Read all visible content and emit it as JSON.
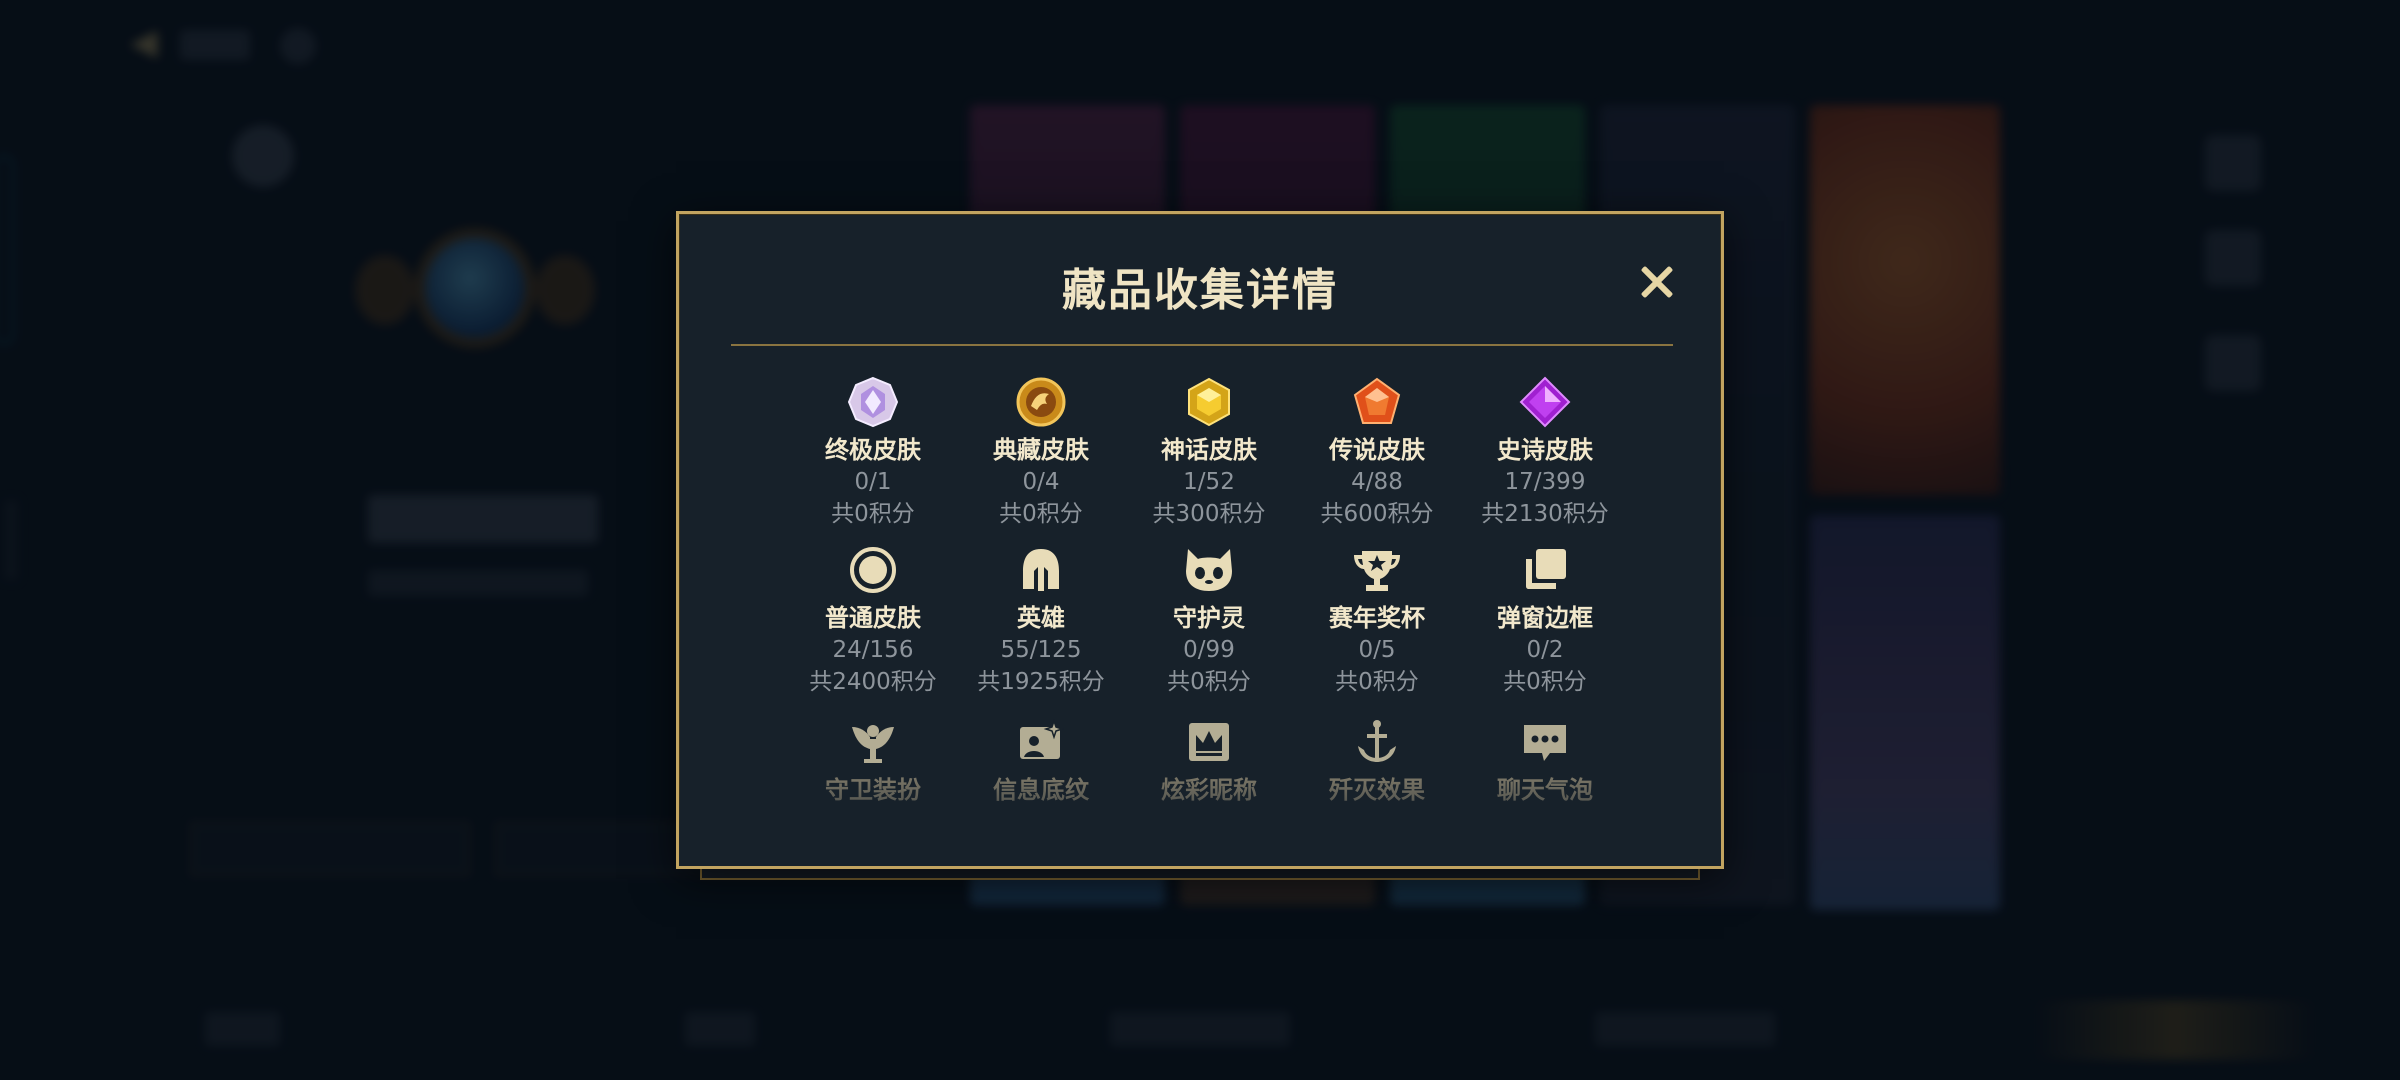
{
  "modal": {
    "title": "藏品收集详情",
    "close_icon": "close-icon"
  },
  "collections": [
    {
      "name": "终极皮肤",
      "count": "0/1",
      "points": "共0积分",
      "icon": "ultimate-gem-icon"
    },
    {
      "name": "典藏皮肤",
      "count": "0/4",
      "points": "共0积分",
      "icon": "dragon-coin-icon"
    },
    {
      "name": "神话皮肤",
      "count": "1/52",
      "points": "共300积分",
      "icon": "mythic-gem-icon"
    },
    {
      "name": "传说皮肤",
      "count": "4/88",
      "points": "共600积分",
      "icon": "legendary-gem-icon"
    },
    {
      "name": "史诗皮肤",
      "count": "17/399",
      "points": "共2130积分",
      "icon": "epic-gem-icon"
    },
    {
      "name": "普通皮肤",
      "count": "24/156",
      "points": "共2400积分",
      "icon": "ring-icon"
    },
    {
      "name": "英雄",
      "count": "55/125",
      "points": "共1925积分",
      "icon": "helmet-icon"
    },
    {
      "name": "守护灵",
      "count": "0/99",
      "points": "共0积分",
      "icon": "guardian-pet-icon"
    },
    {
      "name": "赛年奖杯",
      "count": "0/5",
      "points": "共0积分",
      "icon": "trophy-icon"
    },
    {
      "name": "弹窗边框",
      "count": "0/2",
      "points": "共0积分",
      "icon": "stacked-frames-icon"
    },
    {
      "name": "守卫装扮",
      "icon": "ward-icon"
    },
    {
      "name": "信息底纹",
      "icon": "banner-sparkle-icon"
    },
    {
      "name": "炫彩昵称",
      "icon": "crown-card-icon"
    },
    {
      "name": "歼灭效果",
      "icon": "anchor-sword-icon"
    },
    {
      "name": "聊天气泡",
      "icon": "chat-bubble-icon"
    }
  ],
  "colors": {
    "gold_border": "#c2a460",
    "panel_bg": "#17212a",
    "title_text": "#efe4c4",
    "muted_text": "#8e959c"
  }
}
